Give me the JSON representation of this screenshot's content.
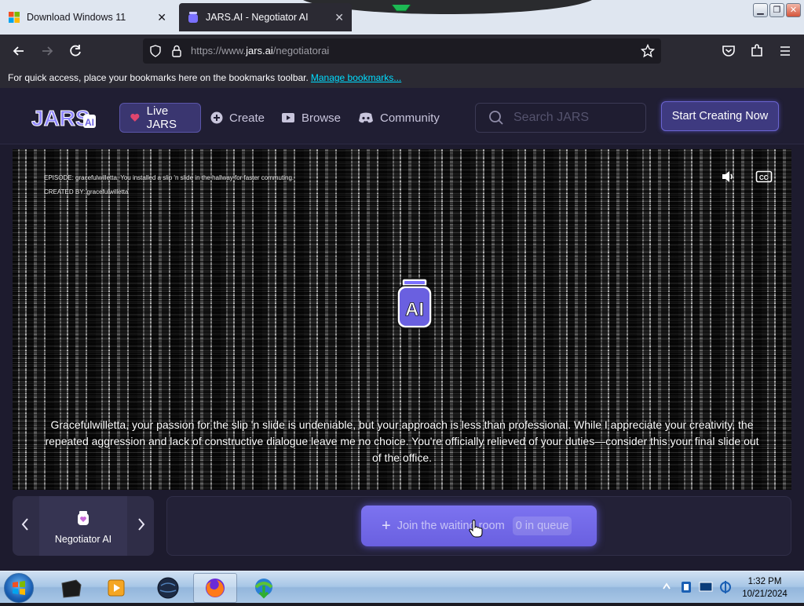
{
  "browser": {
    "tabs": [
      {
        "title": "Download Windows 11",
        "favicon": "windows-logo-icon",
        "active": false
      },
      {
        "title": "JARS.AI - Negotiator AI",
        "favicon": "jars-icon",
        "active": true
      }
    ],
    "url_prefix": "https://www.",
    "url_domain": "jars.ai",
    "url_path": "/negotiatorai",
    "bookmarks_hint": "For quick access, place your bookmarks here on the bookmarks toolbar.",
    "bookmarks_link": "Manage bookmarks..."
  },
  "site": {
    "logo_text": "JARS",
    "logo_badge": "AI",
    "nav": {
      "live": "Live JARS",
      "create": "Create",
      "browse": "Browse",
      "community": "Community"
    },
    "search_placeholder": "Search JARS",
    "start_button": "Start Creating Now"
  },
  "video": {
    "episode_line": "EPISODE: gracefulwilletta, You installed a slip 'n slide in the hallway for faster commuting.",
    "created_by_line": "CREATED BY: gracefulwilletta",
    "center_icon_text": "AI",
    "caption": "Gracefulwilletta, your passion for the slip 'n slide is undeniable, but your approach is less than professional. While I appreciate your creativity, the repeated aggression and lack of constructive dialogue leave me no choice. You're officially relieved of your duties—consider this your final slide out of the office."
  },
  "character": {
    "name": "Negotiator AI"
  },
  "queue": {
    "join_label": "Join the waiting room",
    "queue_count": "0 in queue"
  },
  "taskbar": {
    "time": "1:32 PM",
    "date": "10/21/2024"
  },
  "colors": {
    "accent": "#6a60e0",
    "live_bg": "#3a3670",
    "link": "#00ddff",
    "live_dot": "#e0456e"
  }
}
